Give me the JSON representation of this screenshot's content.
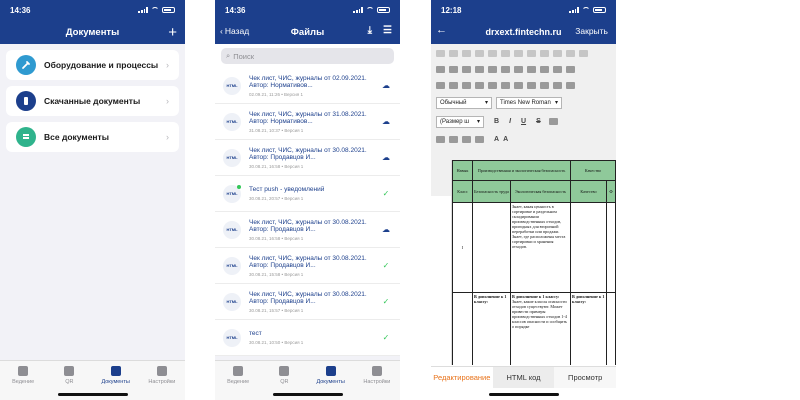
{
  "phone1": {
    "time": "14:36",
    "title": "Документы",
    "add_icon": "+",
    "cards": [
      {
        "label": "Оборудование и процессы",
        "color": "#2f9ad0",
        "icon": "wrench-icon"
      },
      {
        "label": "Скачанные документы",
        "color": "#1c3f8c",
        "icon": "phone-icon"
      },
      {
        "label": "Все документы",
        "color": "#2fb38c",
        "icon": "stack-icon"
      }
    ]
  },
  "phone2": {
    "time": "14:36",
    "back_label": "Назад",
    "title": "Файлы",
    "search_placeholder": "Поиск",
    "files": [
      {
        "title": "Чек лист, ЧИС, журналы от 02.09.2021. Автор: Нормативов...",
        "meta": "02.09.21, 11:26  •  Версия 1",
        "action": "download",
        "dot": false
      },
      {
        "title": "Чек лист, ЧИС, журналы от 31.08.2021. Автор: Нормативов...",
        "meta": "31.08.21, 10:37  •  Версия 1",
        "action": "download",
        "dot": false
      },
      {
        "title": "Чек лист, ЧИС, журналы от 30.08.2021. Автор: Продавцов И...",
        "meta": "30.08.21, 16:58  •  Версия 1",
        "action": "download",
        "dot": false
      },
      {
        "title": "Тест push - уведомлений",
        "meta": "30.08.21, 20:57  •  Версия 1",
        "action": "done",
        "dot": true
      },
      {
        "title": "Чек лист, ЧИС, журналы от 30.08.2021. Автор: Продавцов И...",
        "meta": "30.08.21, 16:58  •  Версия 1",
        "action": "download",
        "dot": false
      },
      {
        "title": "Чек лист, ЧИС, журналы от 30.08.2021. Автор: Продавцов И...",
        "meta": "30.08.21, 15:58  •  Версия 1",
        "action": "done",
        "dot": false
      },
      {
        "title": "Чек лист, ЧИС, журналы от 30.08.2021. Автор: Продавцов И...",
        "meta": "30.08.21, 15:57  •  Версия 1",
        "action": "done",
        "dot": false
      },
      {
        "title": "тест",
        "meta": "30.08.21, 10:50  •  Версия 1",
        "action": "done",
        "dot": false
      }
    ]
  },
  "tabs": [
    {
      "label": "Ведение",
      "icon": "checklist-icon"
    },
    {
      "label": "QR",
      "icon": "qr-icon"
    },
    {
      "label": "Документы",
      "icon": "document-icon"
    },
    {
      "label": "Настройки",
      "icon": "gear-icon"
    }
  ],
  "phone3": {
    "time": "12:18",
    "url": "drxext.fintechn.ru",
    "close_label": "Закрыть",
    "style_select": "Обычный",
    "font_select": "Times New Roman",
    "size_select": "(Размер ш",
    "bottom_tabs": [
      "Редактирование",
      "HTML код",
      "Просмотр"
    ],
    "table": {
      "h_top": [
        "Навык",
        "Производственная и экологическая безопасность",
        "Качество"
      ],
      "h_sub": [
        "Класс",
        "Безопасность труда",
        "Экологическая безопасность",
        "Качество",
        "Ф"
      ],
      "row1_num": "I",
      "row1_text": "Знает, какая ценность в сортировке и раздельном складировании производственных отходов, пригодных для вторичной переработки или продажи. Знает, где расположены места сортировки и хранения отходов.",
      "row2_a": "В дополнение к 1 классу:",
      "row2_b": "В дополнение к 1 классу:",
      "row2_text": "Знает, какие классы опасности отходов существуют. Может привести примеры производственных отходов 1-4 классов опасности и сообщить о порядке",
      "row2_c": "В дополнение к 1 классу:"
    }
  }
}
